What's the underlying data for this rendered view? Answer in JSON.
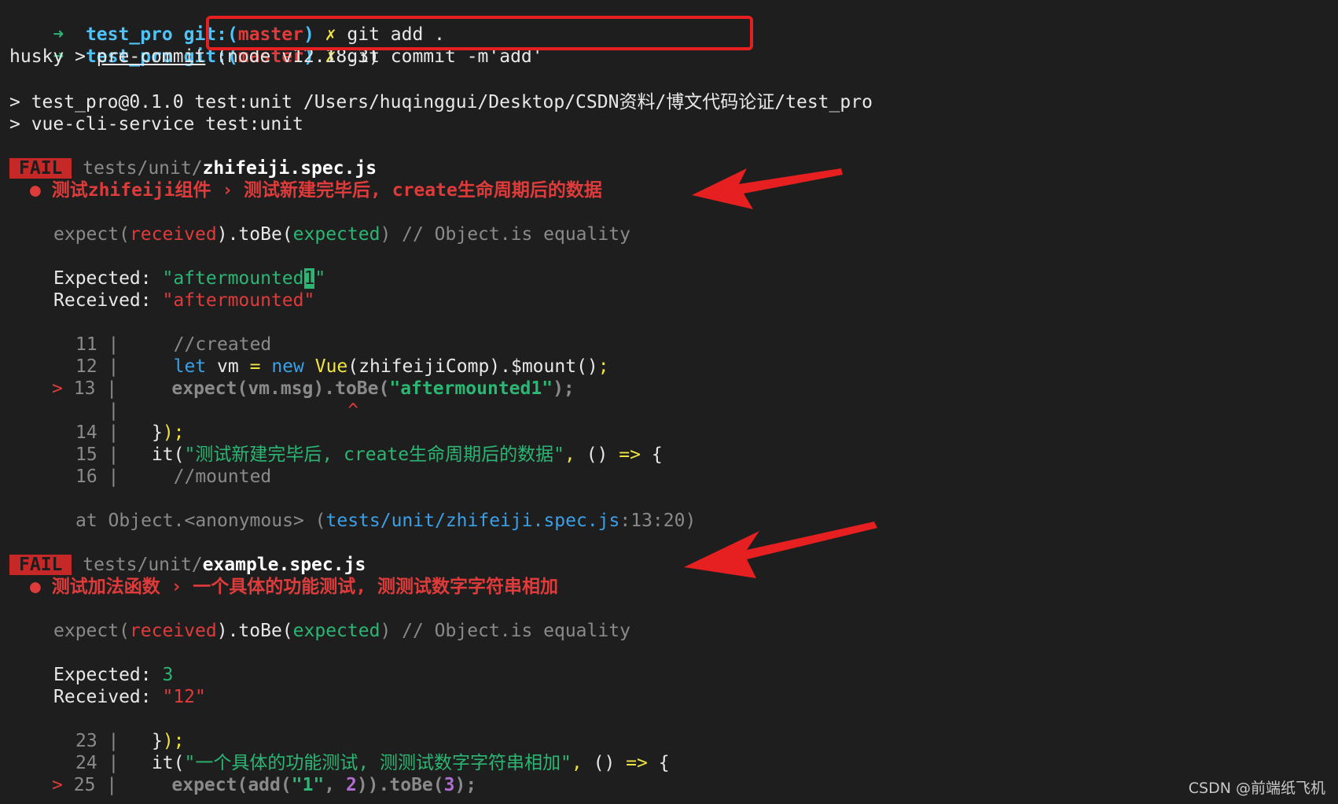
{
  "prompt": {
    "arrow": "➜",
    "dir": "test_pro",
    "git_prefix": "git:(",
    "branch": "master",
    "git_suffix": ")",
    "dirty": "✗"
  },
  "commands": {
    "cmd1": "git add .",
    "cmd2": "git commit -m'add'"
  },
  "husky": {
    "prefix": "husky > ",
    "hook": "pre-commit",
    "node": " (node v12.18.3)"
  },
  "npm": {
    "line1": "> test_pro@0.1.0 test:unit /Users/huqinggui/Desktop/CSDN资料/博文代码论证/test_pro",
    "line2": "> vue-cli-service test:unit"
  },
  "fail_badge": "FAIL",
  "suite1": {
    "path_dir": "tests/unit/",
    "path_file": "zhifeiji.spec.js",
    "bullet": "●",
    "title": "测试zhifeiji组件 › 测试新建完毕后, create生命周期后的数据",
    "expect_line": {
      "a": "expect(",
      "b": "received",
      "c": ").toBe(",
      "d": "expected",
      "e": ") // Object.is equality"
    },
    "expected_label": "Expected: ",
    "expected_value_pre": "\"aftermounted",
    "expected_value_cursor": "1",
    "expected_value_post": "\"",
    "received_label": "Received: ",
    "received_value": "\"aftermounted\"",
    "code": [
      {
        "num": "11",
        "text": "    //created"
      },
      {
        "num": "12",
        "text": "    let vm = new Vue(zhifeijiComp).$mount();"
      },
      {
        "num": "13",
        "text": "    expect(vm.msg).toBe(\"aftermounted1\");"
      },
      {
        "num": "14",
        "text": "  });"
      },
      {
        "num": "15",
        "text": "  it(\"测试新建完毕后, create生命周期后的数据\", () => {"
      },
      {
        "num": "16",
        "text": "    //mounted"
      }
    ],
    "marker": ">",
    "caret": "^",
    "at_prefix": "at Object.<anonymous> (",
    "at_path": "tests/unit/zhifeiji.spec.js",
    "at_suffix": ":13:20)"
  },
  "suite2": {
    "path_dir": "tests/unit/",
    "path_file": "example.spec.js",
    "bullet": "●",
    "title": "测试加法函数 › 一个具体的功能测试, 测测试数字字符串相加",
    "expected_label": "Expected: ",
    "expected_value": "3",
    "received_label": "Received: ",
    "received_value": "\"12\"",
    "code": [
      {
        "num": "23",
        "text": "  });"
      },
      {
        "num": "24",
        "text": "  it(\"一个具体的功能测试, 测测试数字字符串相加\", () => {"
      },
      {
        "num": "25",
        "text": "    expect(add(\"1\", 2)).toBe(3);"
      }
    ],
    "marker": ">"
  },
  "watermark": "CSDN @前端纸飞机",
  "colors": {
    "background": "#1e1e1e",
    "fail_badge": "#c62828",
    "annotation_red": "#e62020",
    "prompt_cyan": "#4fc3f7",
    "string_green": "#2bb673"
  }
}
